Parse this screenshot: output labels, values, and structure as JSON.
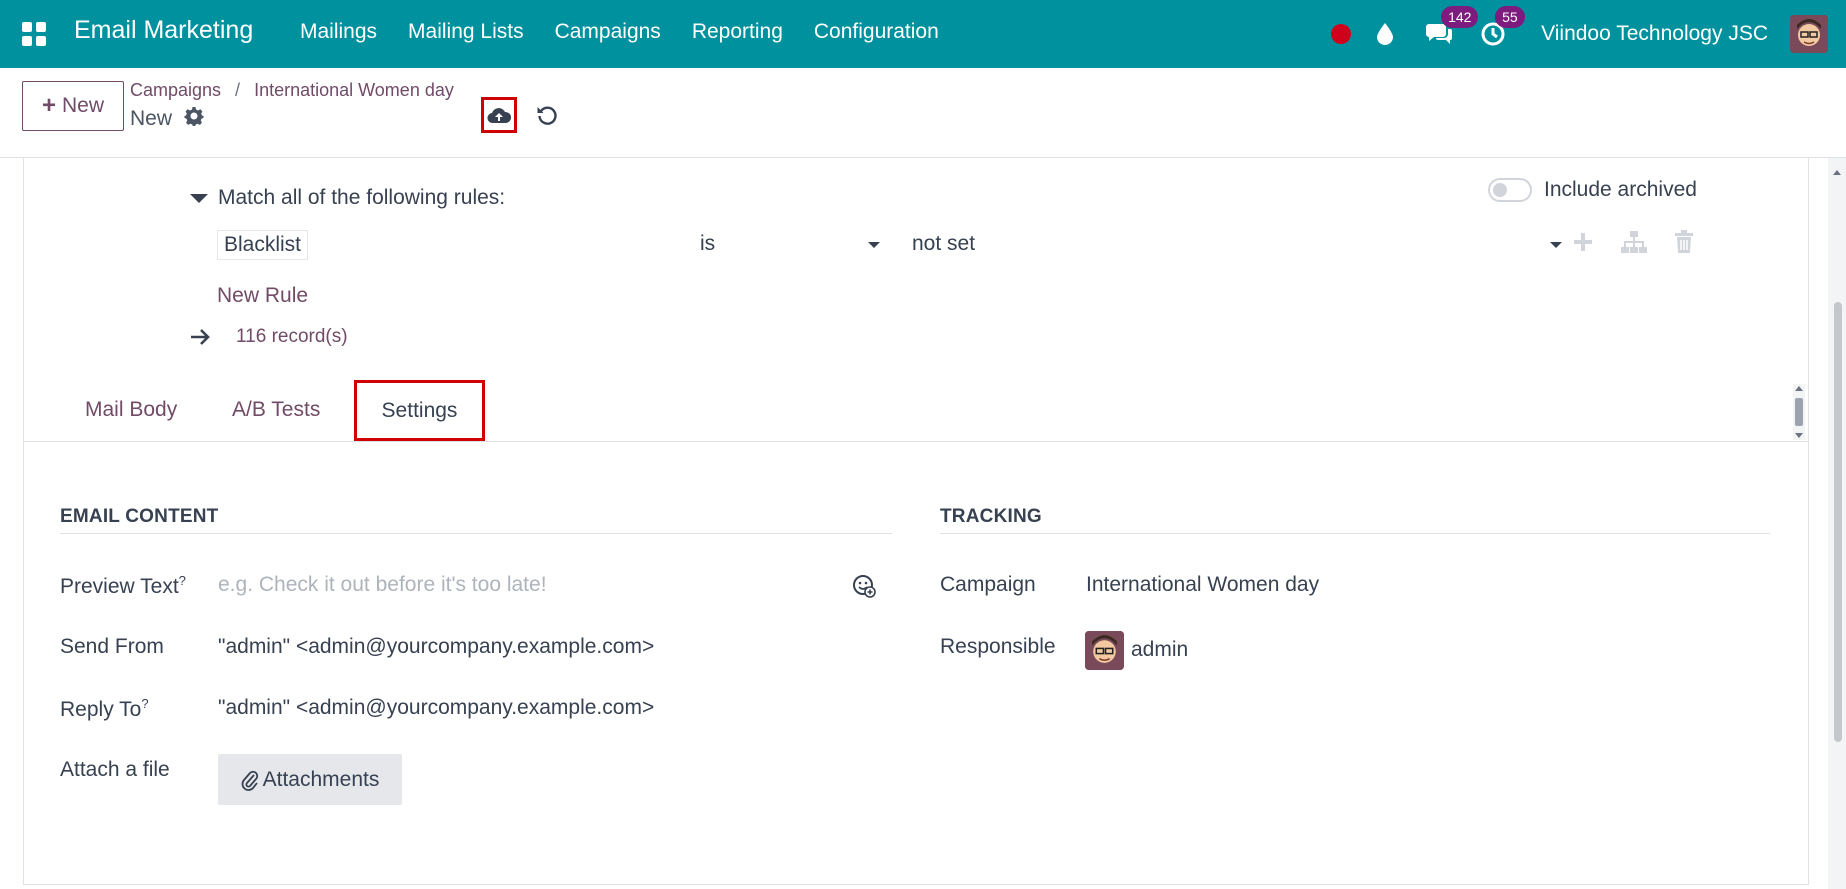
{
  "navbar": {
    "app_title": "Email Marketing",
    "menu": [
      "Mailings",
      "Mailing Lists",
      "Campaigns",
      "Reporting",
      "Configuration"
    ],
    "messages_badge": "142",
    "activities_badge": "55",
    "company": "Viindoo Technology JSC",
    "bg_color": "#00919E"
  },
  "control_panel": {
    "new_label": "New",
    "breadcrumb": [
      "Campaigns",
      "International Women day"
    ],
    "breadcrumb_sep": "/",
    "record_name": "New"
  },
  "domain": {
    "match_label": "Match all of the following rules:",
    "include_archived_label": "Include archived",
    "include_archived": false,
    "rule": {
      "field": "Blacklist",
      "operator": "is",
      "value": "not set"
    },
    "new_rule_label": "New Rule",
    "records_label": "116 record(s)"
  },
  "tabs": {
    "mail_body": "Mail Body",
    "ab_tests": "A/B Tests",
    "settings": "Settings",
    "active": "Settings"
  },
  "email_content": {
    "title": "EMAIL CONTENT",
    "preview_text_label": "Preview Text",
    "preview_text_placeholder": "e.g. Check it out before it's too late!",
    "tooltip_mark": "?",
    "send_from_label": "Send From",
    "send_from_value": "\"admin\" <admin@yourcompany.example.com>",
    "reply_to_label": "Reply To",
    "reply_to_value": "\"admin\" <admin@yourcompany.example.com>",
    "attach_label": "Attach a file",
    "attachments_button": "Attachments"
  },
  "tracking": {
    "title": "TRACKING",
    "campaign_label": "Campaign",
    "campaign_value": "International Women day",
    "responsible_label": "Responsible",
    "responsible_value": "admin"
  },
  "colors": {
    "accent": "#714B67",
    "highlight_border": "#D00000",
    "badge": "#7D1B7E",
    "recording": "#D0021B"
  }
}
